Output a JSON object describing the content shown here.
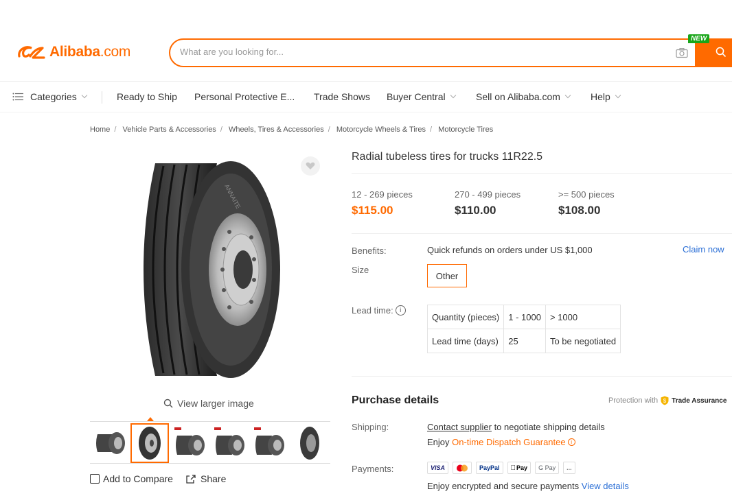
{
  "header": {
    "logo_text": "Alibaba",
    "logo_suffix": ".com",
    "search_placeholder": "What are you looking for...",
    "new_badge": "NEW"
  },
  "nav": {
    "categories": "Categories",
    "items": [
      "Ready to Ship",
      "Personal Protective E...",
      "Trade Shows",
      "Buyer Central",
      "Sell on Alibaba.com",
      "Help"
    ]
  },
  "breadcrumb": [
    "Home",
    "Vehicle Parts & Accessories",
    "Wheels, Tires & Accessories",
    "Motorcycle Wheels & Tires",
    "Motorcycle Tires"
  ],
  "gallery": {
    "view_larger": "View larger image",
    "add_to_compare": "Add to Compare",
    "share": "Share",
    "thumbnail_count": 6,
    "active_thumbnail": 2
  },
  "product": {
    "title": "Radial tubeless tires for trucks 11R22.5",
    "price_tiers": [
      {
        "range": "12 - 269 pieces",
        "price": "$115.00"
      },
      {
        "range": "270 - 499 pieces",
        "price": "$110.00"
      },
      {
        "range": ">= 500 pieces",
        "price": "$108.00"
      }
    ],
    "benefits_label": "Benefits:",
    "benefits_value": "Quick refunds on orders under US $1,000",
    "claim_now": "Claim now",
    "size_label": "Size",
    "size_option": "Other",
    "lead_time_label": "Lead time:",
    "lead_table": {
      "row1": [
        "Quantity (pieces)",
        "1 - 1000",
        "> 1000"
      ],
      "row2": [
        "Lead time (days)",
        "25",
        "To be negotiated"
      ]
    }
  },
  "purchase": {
    "title": "Purchase details",
    "protection_prefix": "Protection with",
    "trade_assurance": "Trade Assurance",
    "shipping_label": "Shipping:",
    "contact_supplier": "Contact supplier",
    "shipping_rest": " to negotiate shipping details",
    "enjoy": "Enjoy ",
    "dispatch_guarantee": "On-time Dispatch Guarantee",
    "payments_label": "Payments:",
    "pay_methods": [
      "VISA",
      "MC",
      "PayPal",
      "Pay",
      "G Pay",
      "..."
    ],
    "secure_note": "Enjoy encrypted and secure payments ",
    "view_details": "View details"
  },
  "colors": {
    "brand": "#ff6a00",
    "link": "#2b6fd6",
    "new_badge": "#1aa61a"
  }
}
